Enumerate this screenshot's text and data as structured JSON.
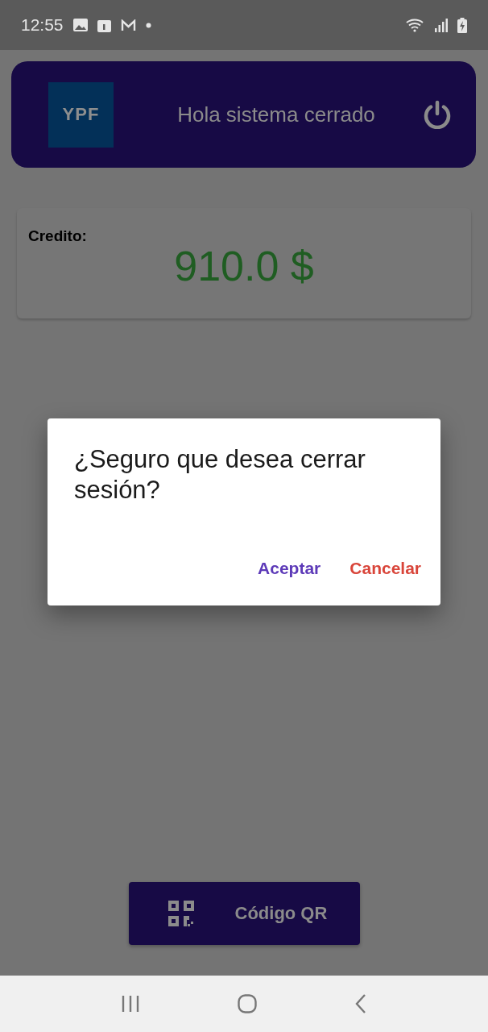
{
  "status_bar": {
    "time": "12:55"
  },
  "header": {
    "logo": "YPF",
    "greeting": "Hola sistema cerrado"
  },
  "credit": {
    "label": "Credito:",
    "amount": "910.0 $"
  },
  "qr_button": {
    "label": "Código QR"
  },
  "dialog": {
    "message": "¿Seguro que desea cerrar sesión?",
    "buttons": [
      {
        "label": "Aceptar",
        "kind": "confirm"
      },
      {
        "label": "Cancelar",
        "kind": "cancel"
      }
    ]
  }
}
